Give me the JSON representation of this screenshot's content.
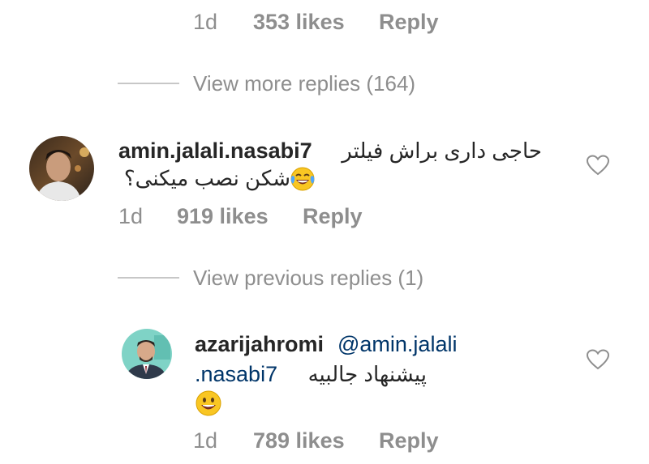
{
  "top_comment": {
    "age": "1d",
    "likes": "353 likes",
    "reply_label": "Reply"
  },
  "view_more": {
    "label": "View more replies (164)"
  },
  "comment_1": {
    "username": "amin.jalali.nasabi7",
    "text_line1": "حاجی داری براش فیلتر",
    "text_line2": "شکن نصب میکنی؟",
    "age": "1d",
    "likes": "919 likes",
    "reply_label": "Reply"
  },
  "view_previous": {
    "label": "View previous replies (1)"
  },
  "comment_2": {
    "username": "azarijahromi",
    "mention": "@amin.jalali",
    "mention_cont": ".nasabi7",
    "text": "پیشنهاد جالبیه",
    "age": "1d",
    "likes": "789 likes",
    "reply_label": "Reply"
  },
  "icons": {
    "heart": "heart-outline-icon",
    "crying_laughing": "face-with-tears-of-joy-icon",
    "smile": "grinning-face-icon"
  }
}
